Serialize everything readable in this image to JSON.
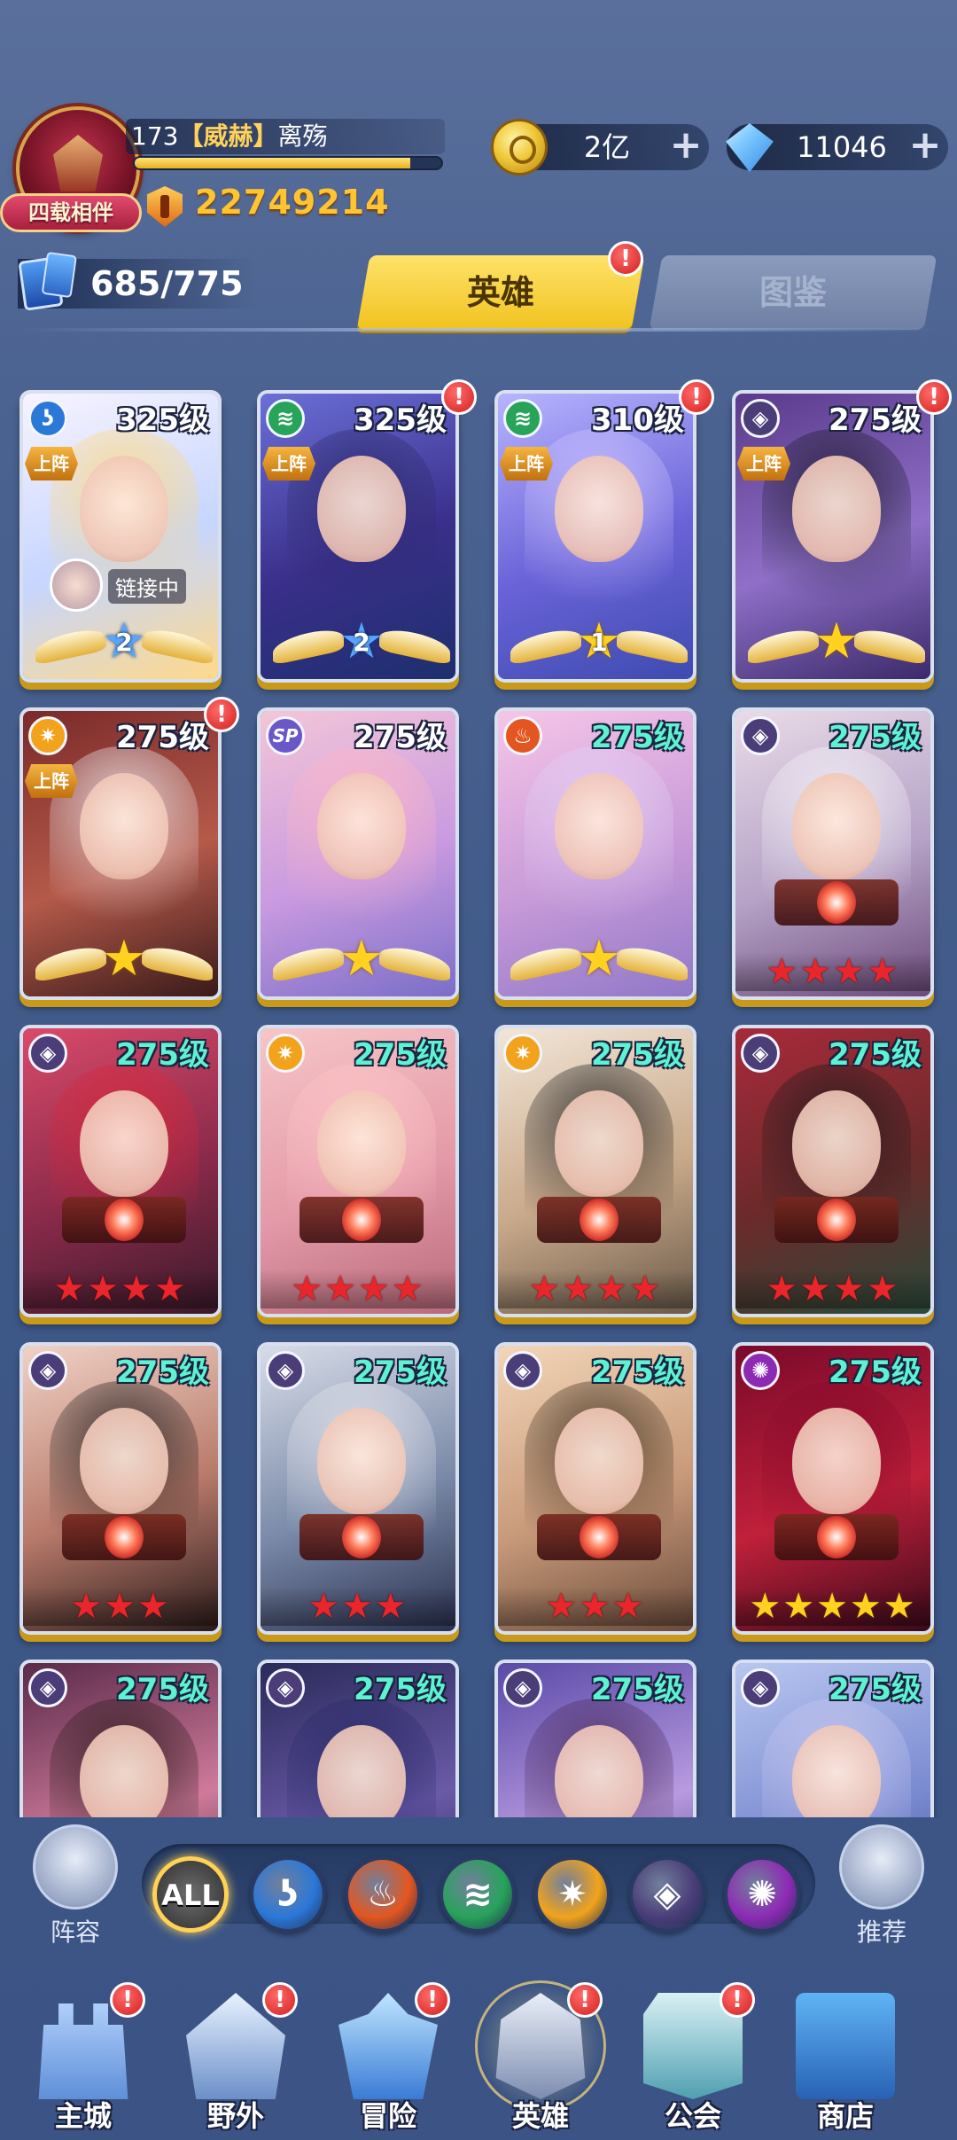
{
  "player": {
    "badge_text": "四载相伴",
    "level": "173",
    "title": "【威赫】",
    "name": "离殇",
    "exp_fraction": 0.9,
    "power": "22749214"
  },
  "currencies": {
    "gold": "2亿",
    "diamonds": "11046"
  },
  "heroes_count": "685/775",
  "tabs": {
    "active": "英雄",
    "inactive": "图鉴"
  },
  "heroes": [
    {
      "level": "325级",
      "faction": "water",
      "deploy": "上阵",
      "link": "链接中",
      "badge": "wing",
      "badge_star": "2",
      "star_color": "blue",
      "dot": false,
      "level_color": "white"
    },
    {
      "level": "325级",
      "faction": "wind",
      "deploy": "上阵",
      "badge": "wing",
      "badge_star": "2",
      "star_color": "blue",
      "dot": true,
      "level_color": "white"
    },
    {
      "level": "310级",
      "faction": "wind",
      "deploy": "上阵",
      "badge": "wing",
      "badge_star": "1",
      "star_color": "gold",
      "dot": true,
      "level_color": "white"
    },
    {
      "level": "275级",
      "faction": "dark",
      "deploy": "上阵",
      "badge": "wing",
      "badge_star": "",
      "star_color": "gold",
      "dot": true,
      "level_color": "white"
    },
    {
      "level": "275级",
      "faction": "light",
      "deploy": "上阵",
      "badge": "wing",
      "badge_star": "",
      "star_color": "gold",
      "dot": true,
      "level_color": "white"
    },
    {
      "level": "275级",
      "faction": "sp",
      "badge": "wing",
      "badge_star": "",
      "star_color": "gold",
      "dot": false,
      "level_color": "white"
    },
    {
      "level": "275级",
      "faction": "fire",
      "badge": "wing",
      "badge_star": "",
      "star_color": "gold",
      "dot": false,
      "level_color": "teal"
    },
    {
      "level": "275级",
      "faction": "dark",
      "stars": "★★★★",
      "star_kind": "red",
      "dot": false,
      "level_color": "teal"
    },
    {
      "level": "275级",
      "faction": "dark",
      "stars": "★★★★",
      "star_kind": "red",
      "dot": false,
      "level_color": "teal"
    },
    {
      "level": "275级",
      "faction": "light",
      "stars": "★★★★",
      "star_kind": "red",
      "dot": false,
      "level_color": "teal"
    },
    {
      "level": "275级",
      "faction": "light",
      "stars": "★★★★",
      "star_kind": "red",
      "dot": false,
      "level_color": "teal"
    },
    {
      "level": "275级",
      "faction": "dark",
      "stars": "★★★★",
      "star_kind": "red",
      "dot": false,
      "level_color": "teal"
    },
    {
      "level": "275级",
      "faction": "dark",
      "stars": "★★★",
      "star_kind": "red",
      "dot": false,
      "level_color": "teal"
    },
    {
      "level": "275级",
      "faction": "dark",
      "stars": "★★★",
      "star_kind": "red",
      "dot": false,
      "level_color": "teal"
    },
    {
      "level": "275级",
      "faction": "dark",
      "stars": "★★★",
      "star_kind": "red",
      "dot": false,
      "level_color": "teal"
    },
    {
      "level": "275级",
      "faction": "chaos",
      "stars": "★★★★★",
      "star_kind": "gold",
      "dot": false,
      "level_color": "teal"
    },
    {
      "level": "275级",
      "faction": "dark",
      "dot": false,
      "level_color": "teal"
    },
    {
      "level": "275级",
      "faction": "dark",
      "dot": false,
      "level_color": "teal"
    },
    {
      "level": "275级",
      "faction": "dark",
      "dot": false,
      "level_color": "teal"
    },
    {
      "level": "275级",
      "faction": "dark",
      "dot": false,
      "level_color": "teal"
    }
  ],
  "filter": {
    "left_label": "阵容",
    "right_label": "推荐",
    "all_label": "ALL",
    "factions": [
      "water",
      "fire",
      "wind",
      "light",
      "dark",
      "chaos"
    ]
  },
  "nav": [
    {
      "label": "主城",
      "icon": "castle-icon",
      "dot": true
    },
    {
      "label": "野外",
      "icon": "wild-icon",
      "dot": true
    },
    {
      "label": "冒险",
      "icon": "adventure-icon",
      "dot": true
    },
    {
      "label": "英雄",
      "icon": "helmet-icon",
      "dot": true,
      "active": true
    },
    {
      "label": "公会",
      "icon": "guild-icon",
      "dot": true
    },
    {
      "label": "商店",
      "icon": "shop-icon",
      "dot": false
    }
  ],
  "colors": {
    "water": "#2a78d8",
    "wind": "#27a35a",
    "fire": "#e4561f",
    "light": "#f2a31b",
    "dark": "#4a3d78",
    "chaos": "#8d2ab4",
    "sp": "#6b58c8"
  }
}
